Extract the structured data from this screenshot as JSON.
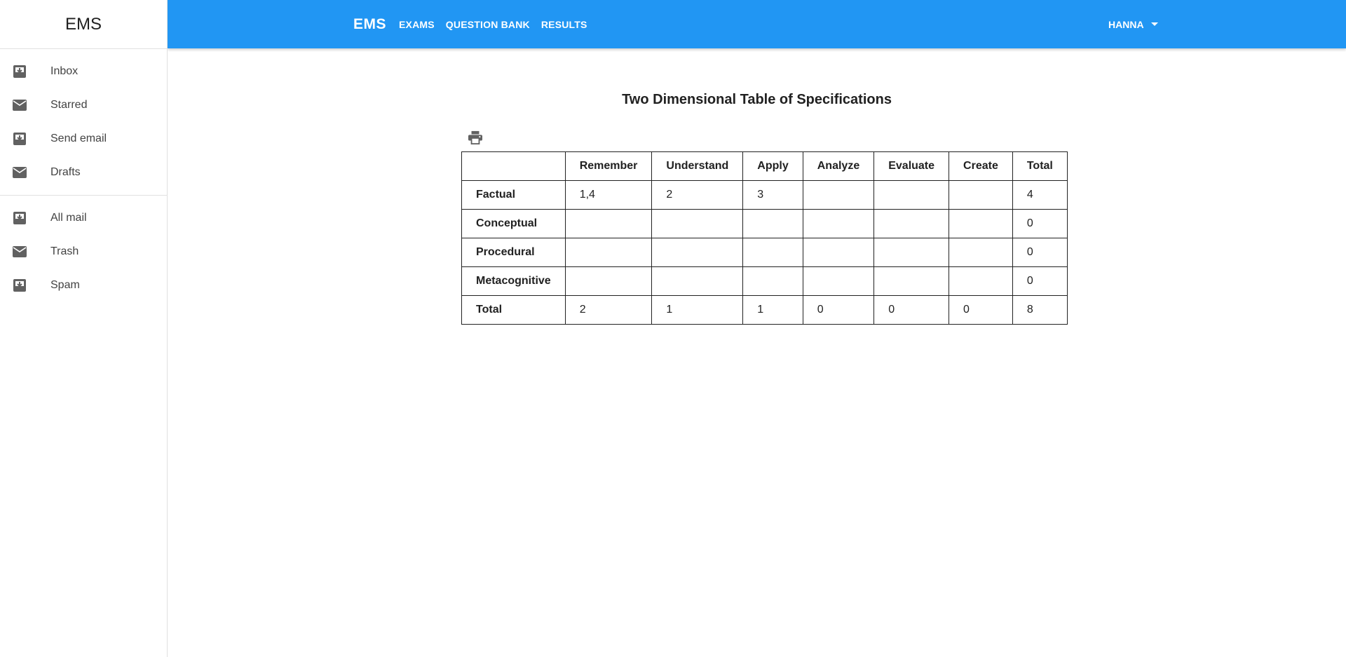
{
  "drawer": {
    "title": "EMS",
    "groups": [
      [
        {
          "label": "Inbox",
          "icon": "inbox-icon"
        },
        {
          "label": "Starred",
          "icon": "mail-icon"
        },
        {
          "label": "Send email",
          "icon": "inbox-icon"
        },
        {
          "label": "Drafts",
          "icon": "mail-icon"
        }
      ],
      [
        {
          "label": "All mail",
          "icon": "inbox-icon"
        },
        {
          "label": "Trash",
          "icon": "mail-icon"
        },
        {
          "label": "Spam",
          "icon": "inbox-icon"
        }
      ]
    ]
  },
  "appbar": {
    "brand": "EMS",
    "nav": [
      "EXAMS",
      "QUESTION BANK",
      "RESULTS"
    ],
    "user": "HANNA",
    "color": "#2196f3"
  },
  "page": {
    "title": "Two Dimensional Table of Specifications",
    "print_icon": "print-icon"
  },
  "table": {
    "columns": [
      "",
      "Remember",
      "Understand",
      "Apply",
      "Analyze",
      "Evaluate",
      "Create",
      "Total"
    ],
    "rows": [
      {
        "label": "Factual",
        "cells": [
          "1,4",
          "2",
          "3",
          "",
          "",
          "",
          "4"
        ]
      },
      {
        "label": "Conceptual",
        "cells": [
          "",
          "",
          "",
          "",
          "",
          "",
          "0"
        ]
      },
      {
        "label": "Procedural",
        "cells": [
          "",
          "",
          "",
          "",
          "",
          "",
          "0"
        ]
      },
      {
        "label": "Metacognitive",
        "cells": [
          "",
          "",
          "",
          "",
          "",
          "",
          "0"
        ]
      },
      {
        "label": "Total",
        "cells": [
          "2",
          "1",
          "1",
          "0",
          "0",
          "0",
          "8"
        ]
      }
    ]
  }
}
